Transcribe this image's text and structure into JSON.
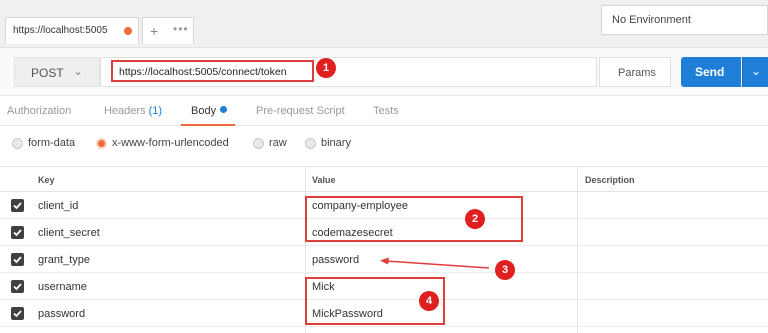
{
  "tab": {
    "url": "https://localhost:5005",
    "new_tab": "+",
    "more": "•••"
  },
  "environment": {
    "selected": "No Environment"
  },
  "request": {
    "method": "POST",
    "url": "https://localhost:5005/connect/token",
    "params_label": "Params",
    "send_label": "Send"
  },
  "subtabs": {
    "authorization": "Authorization",
    "headers": "Headers",
    "headers_count": "(1)",
    "body": "Body",
    "pre_request": "Pre-request Script",
    "tests": "Tests"
  },
  "body_types": {
    "options": [
      "form-data",
      "x-www-form-urlencoded",
      "raw",
      "binary"
    ],
    "selected": "x-www-form-urlencoded"
  },
  "table": {
    "headers": {
      "key": "Key",
      "value": "Value",
      "description": "Description"
    },
    "rows": [
      {
        "checked": true,
        "key": "client_id",
        "value": "company-employee"
      },
      {
        "checked": true,
        "key": "client_secret",
        "value": "codemazesecret"
      },
      {
        "checked": true,
        "key": "grant_type",
        "value": "password"
      },
      {
        "checked": true,
        "key": "username",
        "value": "Mick"
      },
      {
        "checked": true,
        "key": "password",
        "value": "MickPassword"
      }
    ]
  },
  "annotations": [
    "1",
    "2",
    "3",
    "4"
  ],
  "colors": {
    "accent": "#f26b3a",
    "send": "#1f7fd8",
    "annotation": "#e02020"
  },
  "icons": {
    "tab_status": "unsaved-dot-icon",
    "method_dropdown": "chevron-down-icon",
    "send_dropdown": "chevron-down-icon",
    "checkbox": "checkmark-icon",
    "arrow": "arrow-left-icon"
  }
}
